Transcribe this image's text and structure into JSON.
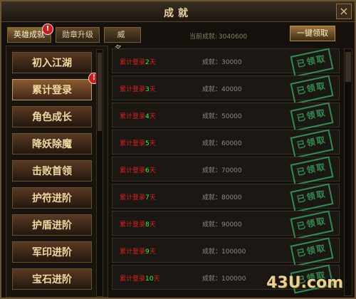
{
  "window": {
    "title": "成就",
    "close_label": "×"
  },
  "tabs": [
    {
      "label": "英雄成就",
      "active": true,
      "badge": "!"
    },
    {
      "label": "勋章升级",
      "active": false
    },
    {
      "label": "威名",
      "active": false
    }
  ],
  "current_points": {
    "label": "当前成就:",
    "value": "3040600"
  },
  "claim_all_label": "一键领取",
  "categories": [
    {
      "label": "初入江湖"
    },
    {
      "label": "累计登录",
      "selected": true,
      "badge": "!"
    },
    {
      "label": "角色成长"
    },
    {
      "label": "降妖除魔"
    },
    {
      "label": "击败首领"
    },
    {
      "label": "护符进阶"
    },
    {
      "label": "护盾进阶"
    },
    {
      "label": "军印进阶"
    },
    {
      "label": "宝石进阶"
    }
  ],
  "rows": [
    {
      "prefix": "累计登录",
      "days": "2",
      "suffix": "天",
      "achievement": "成就：30000",
      "stamp": "已领取"
    },
    {
      "prefix": "累计登录",
      "days": "3",
      "suffix": "天",
      "achievement": "成就：40000",
      "stamp": "已领取"
    },
    {
      "prefix": "累计登录",
      "days": "4",
      "suffix": "天",
      "achievement": "成就：50000",
      "stamp": "已领取"
    },
    {
      "prefix": "累计登录",
      "days": "5",
      "suffix": "天",
      "achievement": "成就：60000",
      "stamp": "已领取"
    },
    {
      "prefix": "累计登录",
      "days": "6",
      "suffix": "天",
      "achievement": "成就：70000",
      "stamp": "已领取"
    },
    {
      "prefix": "累计登录",
      "days": "7",
      "suffix": "天",
      "achievement": "成就：80000",
      "stamp": "已领取"
    },
    {
      "prefix": "累计登录",
      "days": "8",
      "suffix": "天",
      "achievement": "成就：90000",
      "stamp": "已领取"
    },
    {
      "prefix": "累计登录",
      "days": "9",
      "suffix": "天",
      "achievement": "成就：100000",
      "stamp": "已领取"
    },
    {
      "prefix": "累计登录",
      "days": "10",
      "suffix": "天",
      "achievement": "成就：100000",
      "stamp": "已领取"
    }
  ],
  "watermark": "43U.com"
}
